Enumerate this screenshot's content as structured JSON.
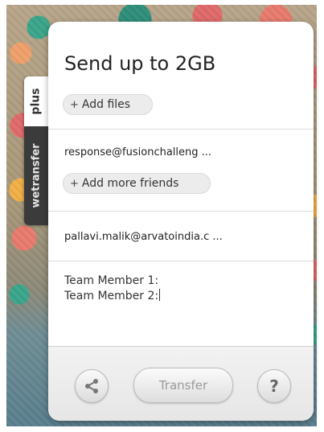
{
  "side_tab": {
    "plus_label": "plus",
    "brand_label": "wetransfer"
  },
  "card": {
    "title": "Send up to 2GB",
    "add_files_label": "Add files",
    "recipient_email": "response@fusionchalleng ...",
    "add_friends_label": "Add more friends",
    "sender_email": "pallavi.malik@arvatoindia.c ...",
    "message_line1": "Team Member 1:",
    "message_line2": "Team Member 2:"
  },
  "footer": {
    "share_icon": "share-icon",
    "transfer_label": "Transfer",
    "help_label": "?"
  }
}
